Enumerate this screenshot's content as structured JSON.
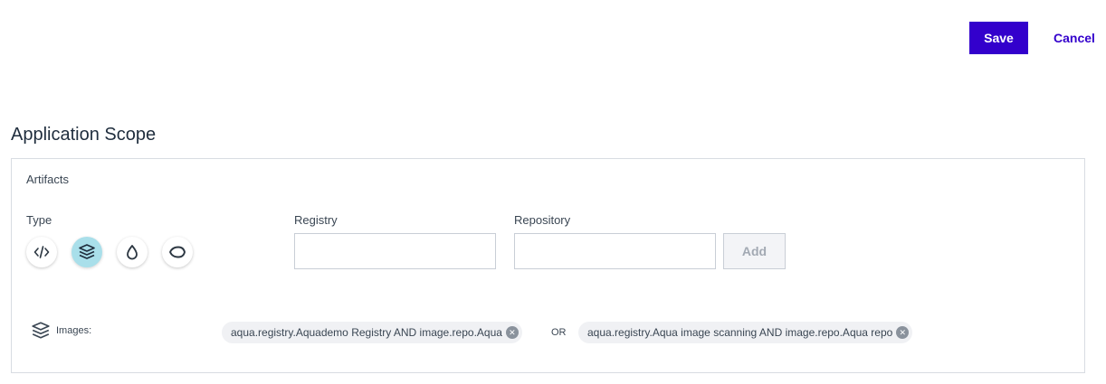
{
  "actions": {
    "save_label": "Save",
    "cancel_label": "Cancel"
  },
  "section": {
    "title": "Application Scope"
  },
  "artifacts": {
    "label": "Artifacts",
    "type_label": "Type",
    "types": [
      {
        "icon": "code-icon",
        "active": false
      },
      {
        "icon": "layers-icon",
        "active": true
      },
      {
        "icon": "drop-icon",
        "active": false
      },
      {
        "icon": "eye-icon",
        "active": false
      }
    ],
    "registry": {
      "label": "Registry",
      "value": "",
      "placeholder": ""
    },
    "repository": {
      "label": "Repository",
      "value": "",
      "placeholder": ""
    },
    "add_label": "Add"
  },
  "images": {
    "label": "Images:",
    "or_label": "OR",
    "chips": [
      {
        "text": "aqua.registry.Aquademo Registry AND image.repo.Aqua"
      },
      {
        "text": "aqua.registry.Aqua image scanning AND image.repo.Aqua repo"
      }
    ]
  },
  "colors": {
    "accent": "#3300cc",
    "active_type_bg": "#a9dfea",
    "chip_bg": "#f0f1f4",
    "border": "#d8dce2"
  }
}
